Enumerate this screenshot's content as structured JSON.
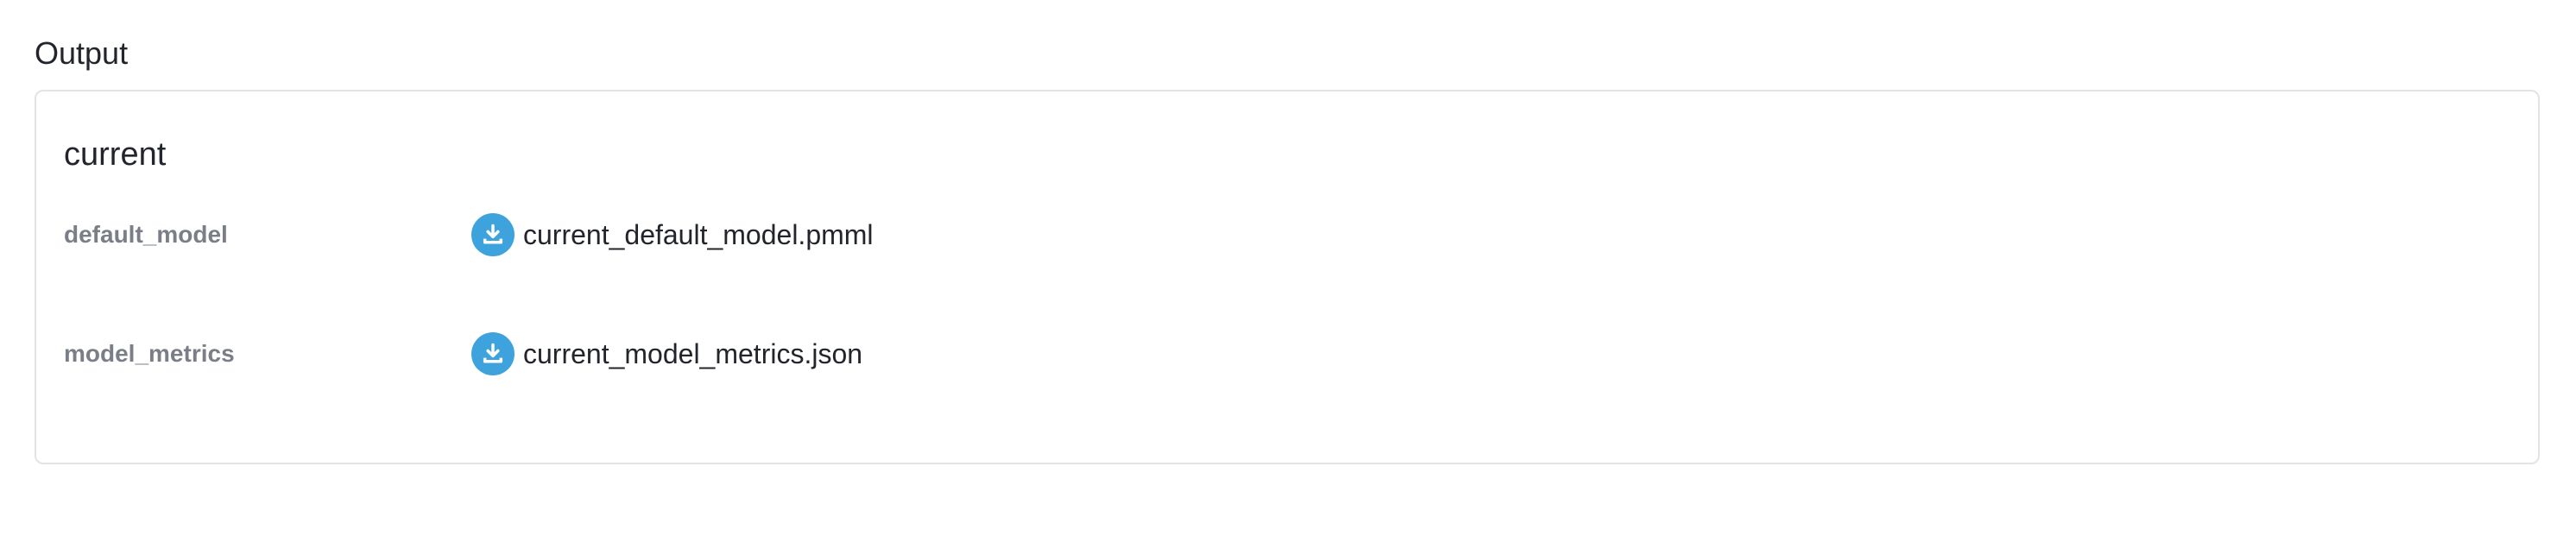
{
  "section": {
    "title": "Output"
  },
  "card": {
    "group_title": "current",
    "rows": [
      {
        "key": "default_model",
        "file": "current_default_model.pmml",
        "icon": "download-icon"
      },
      {
        "key": "model_metrics",
        "file": "current_model_metrics.json",
        "icon": "download-icon"
      }
    ]
  },
  "colors": {
    "accent": "#3ea3dc",
    "border": "#e1e3e6",
    "muted_text": "#7a7f87",
    "text": "#22252b"
  }
}
